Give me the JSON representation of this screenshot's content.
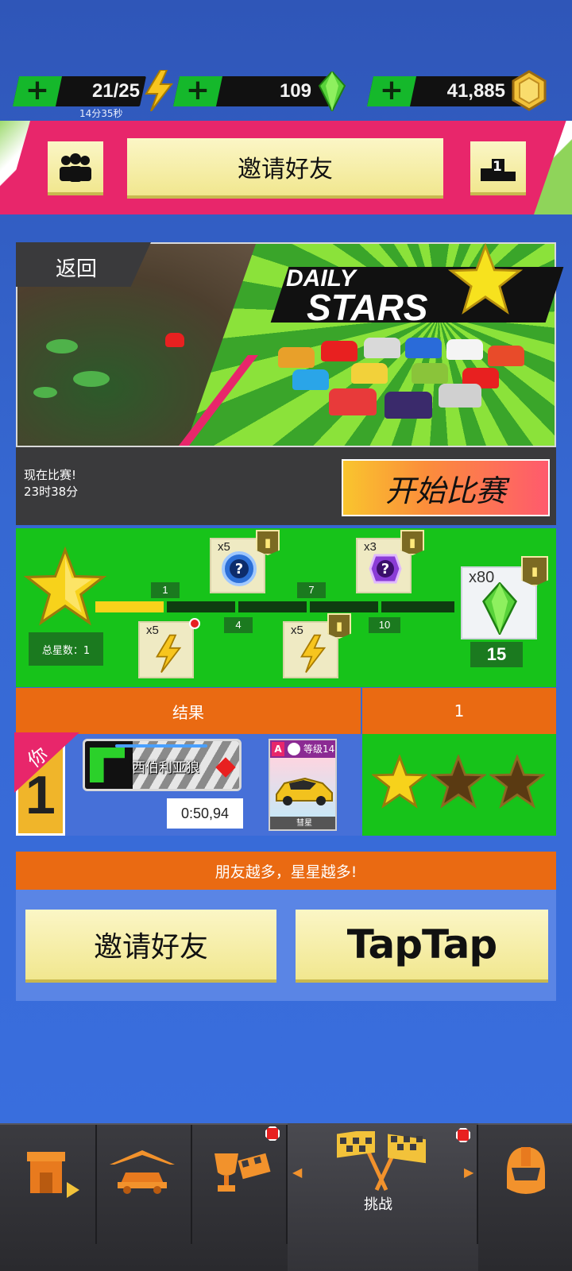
{
  "resources": {
    "energy": {
      "value": "21/25",
      "timer": "14分35秒"
    },
    "gems": {
      "value": "109"
    },
    "coins": {
      "value": "41,885"
    }
  },
  "header": {
    "invite_label": "邀请好友",
    "rank_number": "1"
  },
  "event": {
    "back_label": "返回",
    "title_line1": "DAILY",
    "title_line2": "STARS",
    "status_line1": "现在比赛!",
    "status_line2": "23时38分",
    "start_label": "开始比赛"
  },
  "progress": {
    "total_stars_label": "总星数：1",
    "current": 1,
    "max": 15,
    "milestones_top": [
      "1",
      "7"
    ],
    "milestones_bottom": [
      "4",
      "10"
    ],
    "final_milestone": "15",
    "rewards": [
      {
        "qty": "x5",
        "kind": "mystery-box-blue"
      },
      {
        "qty": "x3",
        "kind": "mystery-box-purple"
      },
      {
        "qty": "x5",
        "kind": "energy"
      },
      {
        "qty": "x5",
        "kind": "energy"
      },
      {
        "qty": "x80",
        "kind": "gem"
      }
    ]
  },
  "results": {
    "header_label": "结果",
    "header_value": "1",
    "you_label": "你",
    "rank": "1",
    "track_name": "西伯利亚狼",
    "time": "0:50,94",
    "car_grade": "A",
    "car_level": "等级14",
    "car_name": "彗星",
    "stars_earned": 1,
    "stars_total": 3
  },
  "friends": {
    "banner": "朋友越多，星星越多!",
    "invite_label": "邀请好友",
    "taptap_label": "TapTap"
  },
  "nav": {
    "items": [
      "shop-icon",
      "garage-icon",
      "trophy-icon",
      "challenge-icon",
      "profile-icon"
    ],
    "active_label": "挑战"
  },
  "colors": {
    "pink": "#e8266b",
    "green": "#17c31a",
    "orange": "#ea6a12",
    "blue_bg": "#3668d2",
    "button_yellow": "#f1e78f"
  }
}
